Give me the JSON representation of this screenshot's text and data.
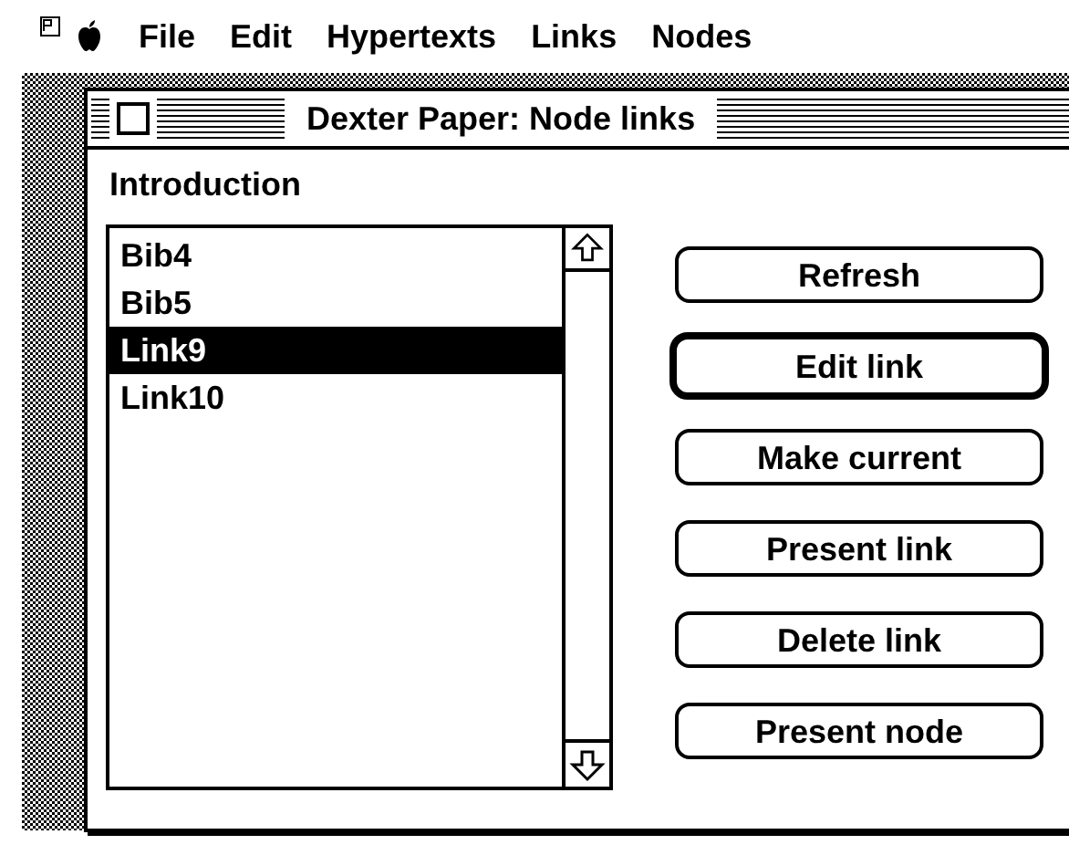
{
  "menu_bar": {
    "items": [
      "File",
      "Edit",
      "Hypertexts",
      "Links",
      "Nodes"
    ]
  },
  "window": {
    "title": "Dexter Paper: Node links"
  },
  "node_name": "Introduction",
  "links": [
    {
      "label": "Bib4",
      "selected": false
    },
    {
      "label": "Bib5",
      "selected": false
    },
    {
      "label": "Link9",
      "selected": true
    },
    {
      "label": "Link10",
      "selected": false
    }
  ],
  "buttons": [
    {
      "label": "Refresh",
      "default": false
    },
    {
      "label": "Edit link",
      "default": true
    },
    {
      "label": "Make current",
      "default": false
    },
    {
      "label": "Present link",
      "default": false
    },
    {
      "label": "Delete link",
      "default": false
    },
    {
      "label": "Present node",
      "default": false
    }
  ]
}
